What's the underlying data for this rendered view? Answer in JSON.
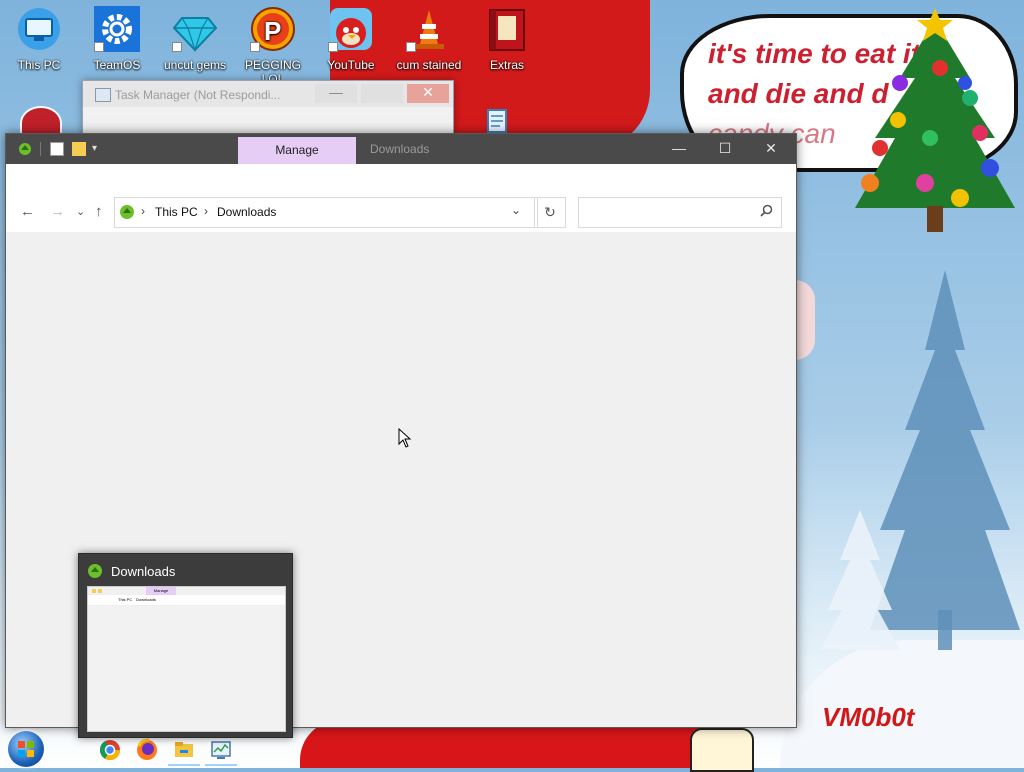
{
  "desktop": {
    "icons": [
      {
        "label": "This PC",
        "icon": "computer-icon"
      },
      {
        "label": "TeamOS",
        "icon": "gear-icon"
      },
      {
        "label": "uncut gems",
        "icon": "diamond-icon"
      },
      {
        "label": "PEGGING LOL",
        "icon": "pegasus-p-icon"
      },
      {
        "label": "YouTube",
        "icon": "angry-bird-icon"
      },
      {
        "label": "cum stained",
        "icon": "traffic-cone-icon"
      },
      {
        "label": "Extras",
        "icon": "red-book-icon"
      }
    ]
  },
  "wallpaper": {
    "speech_line1": "it's time to eat it",
    "speech_line2": "and die and d",
    "speech_line3": "candy can",
    "signature": "VM0b0t",
    "accent": "#cc2030"
  },
  "task_manager": {
    "title": "Task Manager (Not Respondi..."
  },
  "explorer": {
    "tab_manage": "Manage",
    "tab_downloads": "Downloads",
    "manage_color": "#e6cdf5",
    "breadcrumb": [
      "This PC",
      "Downloads"
    ],
    "search_placeholder": "",
    "minimize": "—",
    "maximize": "☐",
    "close": "✕"
  },
  "taskbar": {
    "items": [
      "chrome-icon",
      "firefox-icon",
      "file-explorer-icon",
      "task-manager-icon"
    ]
  },
  "preview": {
    "title": "Downloads",
    "mini_tab": "Manage",
    "mini_crumb1": "This PC",
    "mini_crumb2": "Downloads"
  }
}
